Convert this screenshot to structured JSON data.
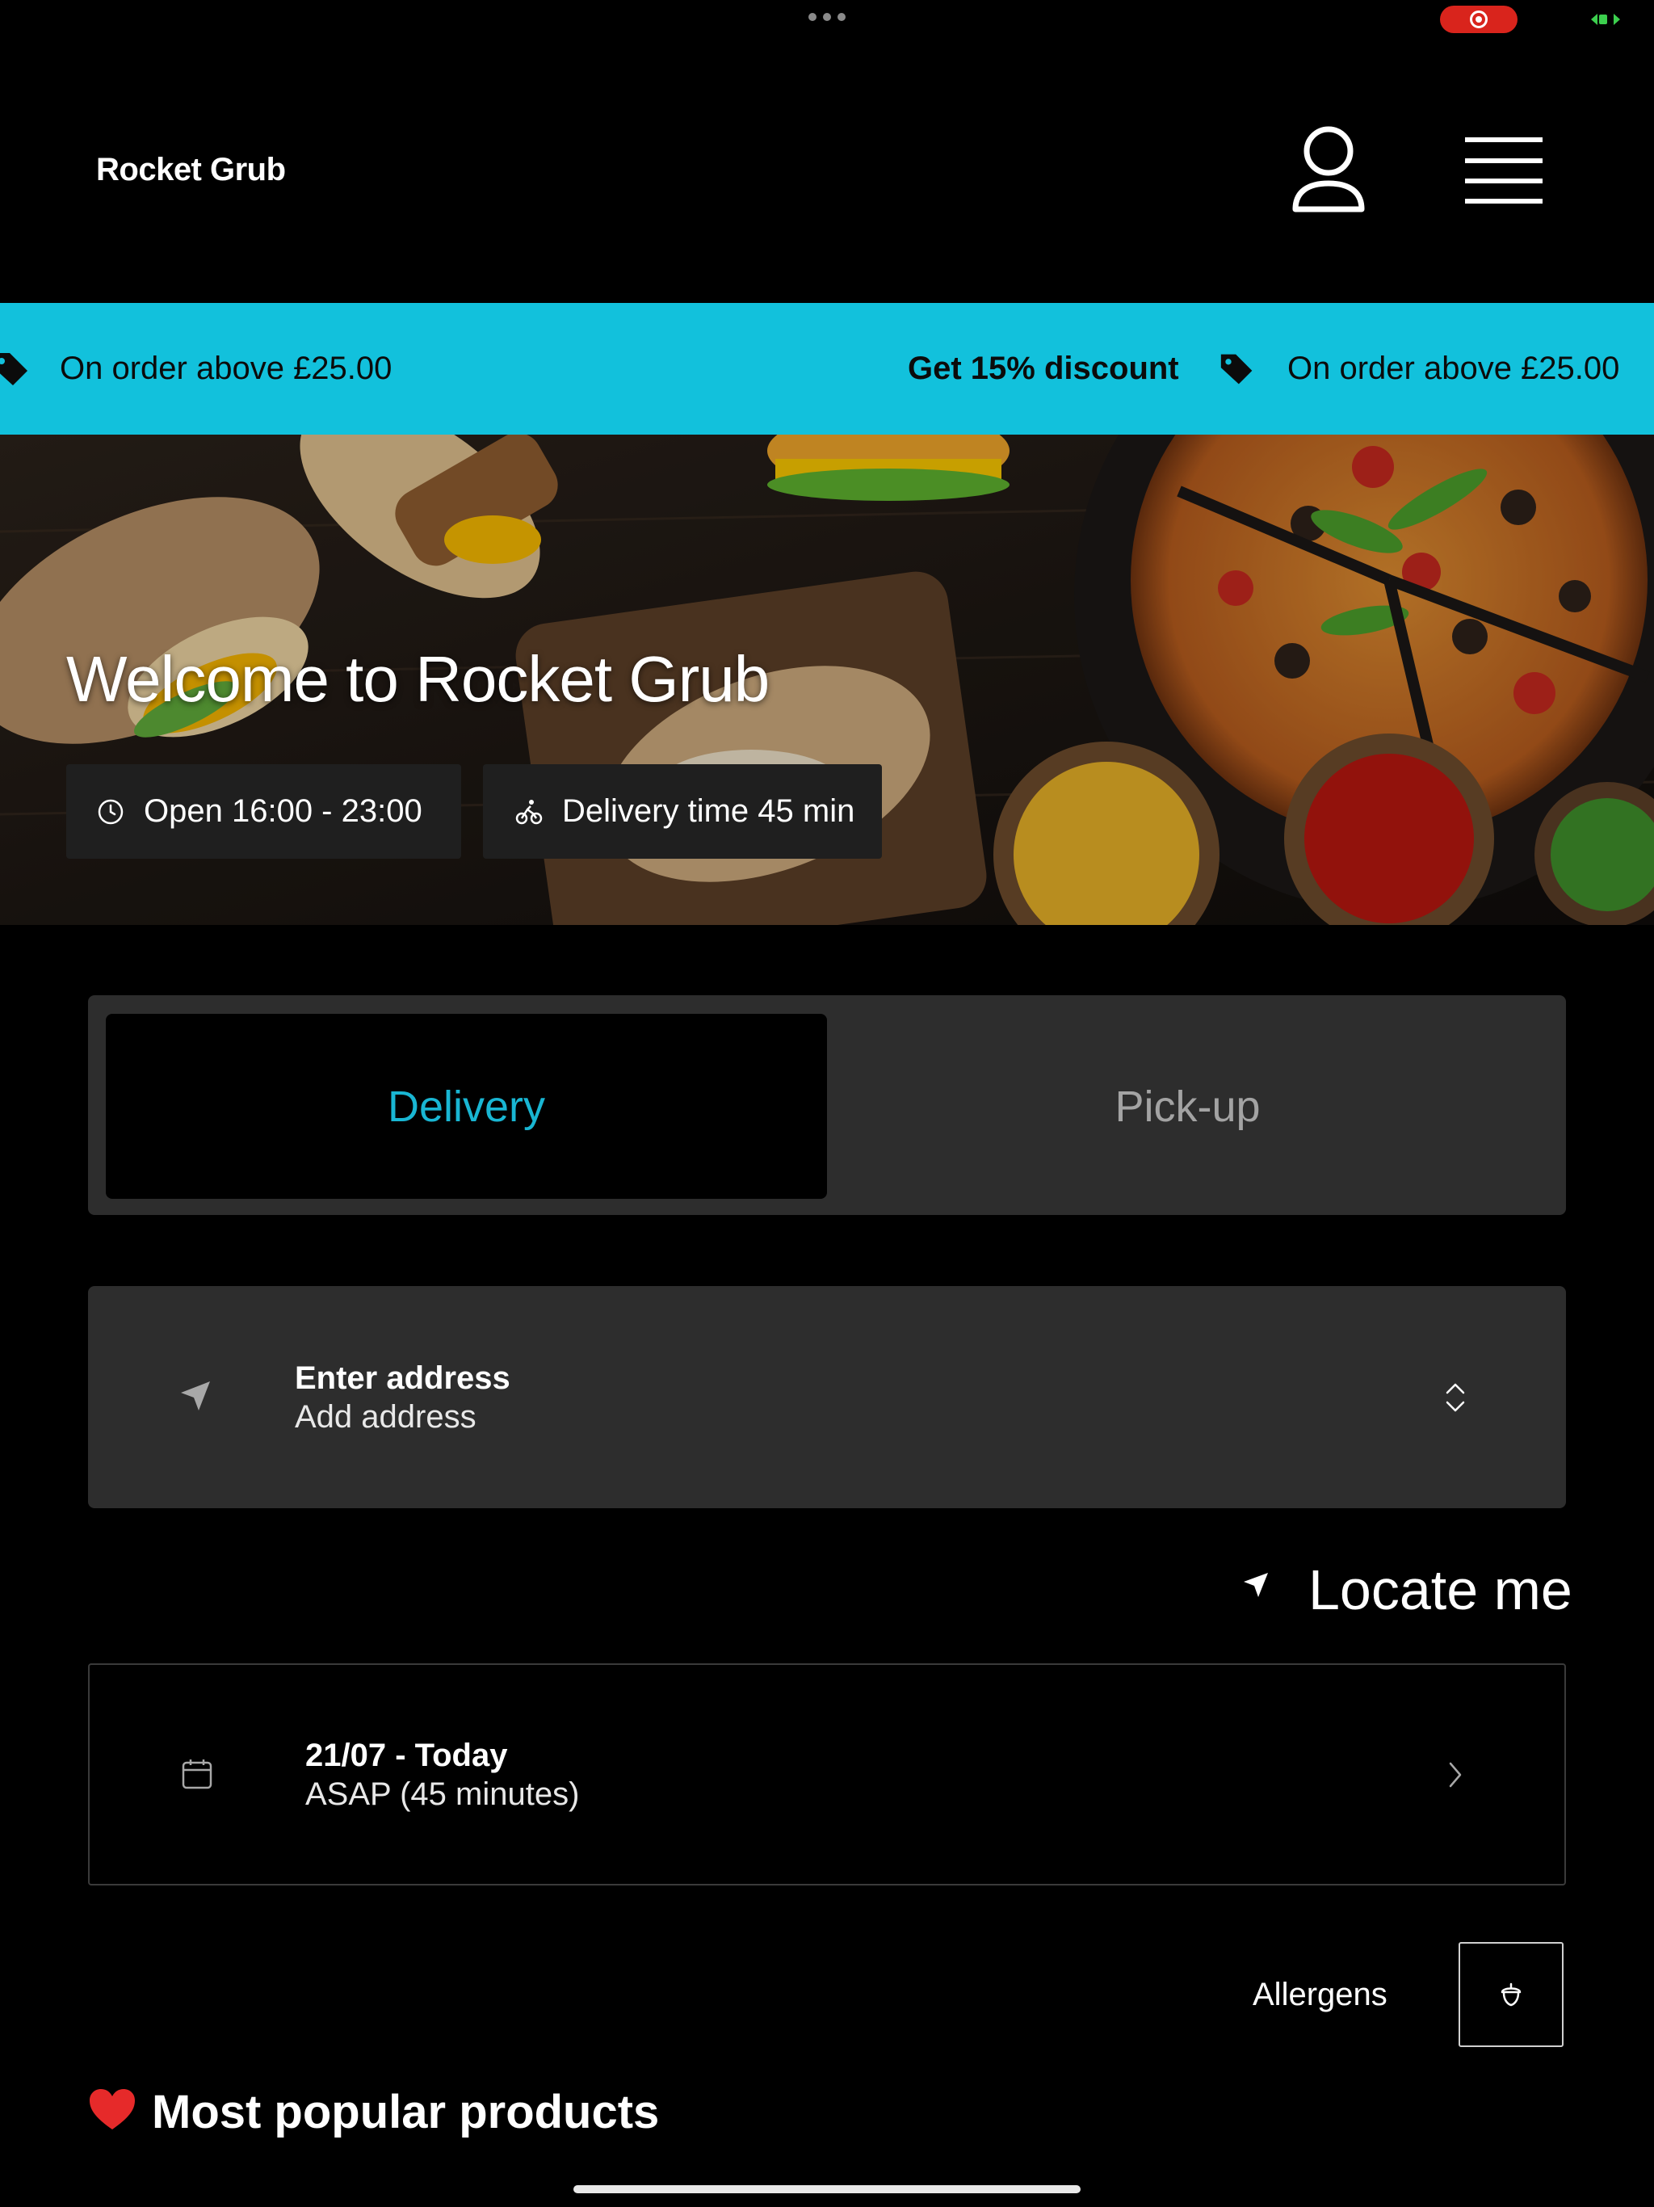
{
  "app": {
    "name": "Rocket Grub"
  },
  "header": {
    "brand": "Rocket Grub",
    "account_icon": "user-icon",
    "menu_icon": "hamburger-menu-icon"
  },
  "promo_banner": {
    "items": [
      {
        "text": "On order above £25.00",
        "bold": false,
        "icon": "tag-icon"
      },
      {
        "text": "Get 15% discount",
        "bold": true
      },
      {
        "text": "On order above £25.00",
        "bold": false,
        "icon": "tag-icon"
      }
    ],
    "color": "#12c1dc"
  },
  "hero": {
    "title": "Welcome to Rocket Grub",
    "opening_hours": "Open 16:00 - 23:00",
    "delivery_time": "Delivery time 45 min"
  },
  "order_mode": {
    "tabs": [
      {
        "label": "Delivery",
        "selected": true
      },
      {
        "label": "Pick-up",
        "selected": false
      }
    ],
    "accent": "#19b6d3"
  },
  "address": {
    "title": "Enter address",
    "subtitle": "Add address"
  },
  "locate": {
    "label": "Locate me"
  },
  "schedule": {
    "date": "21/07 - Today",
    "time": "ASAP (45 minutes)"
  },
  "allergens": {
    "label": "Allergens",
    "icon": "acorn-icon"
  },
  "sections": {
    "popular": {
      "emoji": "❤️",
      "title": "Most popular products"
    }
  }
}
